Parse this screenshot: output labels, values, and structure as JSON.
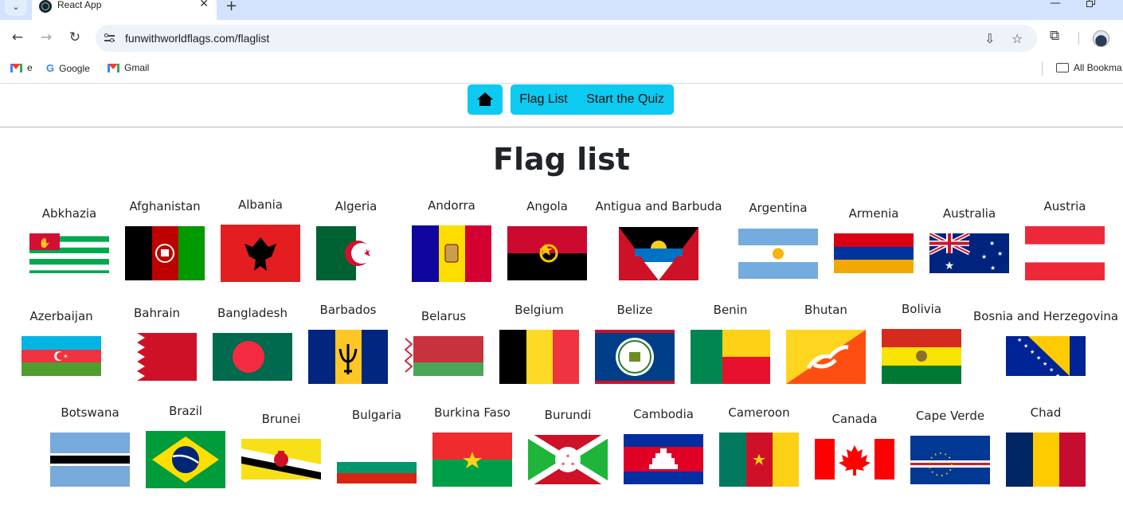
{
  "browser": {
    "tab_title": "React App",
    "url": "funwithworldflags.com/flaglist",
    "bookmarks": [
      {
        "label": "e",
        "icon": "gmail-icon"
      },
      {
        "label": "Google",
        "icon": "google-icon"
      },
      {
        "label": "Gmail",
        "icon": "gmail-icon"
      }
    ],
    "all_bookmarks_label": "All Bookma"
  },
  "nav": {
    "flag_list_label": "Flag List",
    "quiz_label": "Start the Quiz",
    "accent_color": "#0dcaf0"
  },
  "page": {
    "heading": "Flag list"
  },
  "flags": [
    {
      "name": "Abkhazia"
    },
    {
      "name": "Afghanistan"
    },
    {
      "name": "Albania"
    },
    {
      "name": "Algeria"
    },
    {
      "name": "Andorra"
    },
    {
      "name": "Angola"
    },
    {
      "name": "Antigua and Barbuda"
    },
    {
      "name": "Argentina"
    },
    {
      "name": "Armenia"
    },
    {
      "name": "Australia"
    },
    {
      "name": "Austria"
    },
    {
      "name": "Azerbaijan"
    },
    {
      "name": "Bahrain"
    },
    {
      "name": "Bangladesh"
    },
    {
      "name": "Barbados"
    },
    {
      "name": "Belarus"
    },
    {
      "name": "Belgium"
    },
    {
      "name": "Belize"
    },
    {
      "name": "Benin"
    },
    {
      "name": "Bhutan"
    },
    {
      "name": "Bolivia"
    },
    {
      "name": "Bosnia and Herzegovina"
    },
    {
      "name": "Botswana"
    },
    {
      "name": "Brazil"
    },
    {
      "name": "Brunei"
    },
    {
      "name": "Bulgaria"
    },
    {
      "name": "Burkina Faso"
    },
    {
      "name": "Burundi"
    },
    {
      "name": "Cambodia"
    },
    {
      "name": "Cameroon"
    },
    {
      "name": "Canada"
    },
    {
      "name": "Cape Verde"
    },
    {
      "name": "Chad"
    }
  ]
}
